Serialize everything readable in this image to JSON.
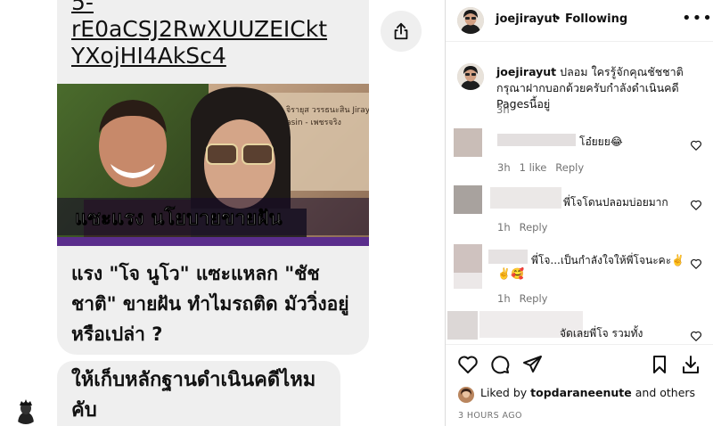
{
  "chat": {
    "link_lines": [
      "5-",
      "rE0aCSJ2RwXUUZEICkt",
      "YXojHI4AkSc4"
    ],
    "preview_headline": "แซะแรง นโยบายขายฝัน",
    "preview_sign_lines": [
      "โจ นูโว จิรายุส วรรธนะสิน Jirayu",
      "Wattanasin - เพชรจริง"
    ],
    "caption": "แรง \"โจ นูโว\" แซะแหลก \"ชัชชาติ\" ขายฝัน ทำไมรถติด มัววิ่งอยู่หรือเปล่า ?",
    "second_message": "ให้เก็บหลักฐานดำเนินคดีไหมคับ",
    "share_icon": "share-icon"
  },
  "post": {
    "header": {
      "username": "joejirayut",
      "dot": "•",
      "follow_status": "Following",
      "more_icon": "more-icon",
      "more_label": "•••"
    },
    "caption": {
      "username": "joejirayut",
      "text": "ปลอม ใครรู้จักคุณชัชชาติกรุณาฝากบอกด้วยครับกำลังดำเนินคดี Pagesนี้อยู่",
      "time": "3h"
    },
    "comments": [
      {
        "text": "โอ๋ยยย😂",
        "time": "3h",
        "likes": "1 like",
        "reply": "Reply"
      },
      {
        "text": "พี่โจโดนปลอมบ่อยมาก",
        "time": "1h",
        "likes": "",
        "reply": "Reply"
      },
      {
        "text": "พี่โจ...เป็นกำลังใจให้พี่โจนะคะ✌️",
        "text2": "✌️🥰",
        "time": "1h",
        "likes": "",
        "reply": "Reply"
      },
      {
        "text": "จัดเลยพี่โจ รวมทั้ง",
        "time": "",
        "likes": "",
        "reply": ""
      }
    ],
    "liked_by": {
      "prefix": "Liked by",
      "user": "topdaraneenute",
      "suffix": "and others"
    },
    "timestamp": "3 HOURS AGO"
  }
}
